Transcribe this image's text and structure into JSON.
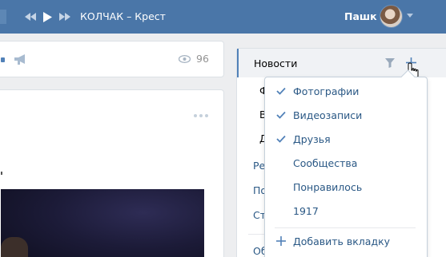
{
  "player": {
    "track": "КОЛЧАК – Крест",
    "prev_icon": "prev-icon",
    "play_icon": "play-icon",
    "next_icon": "next-icon"
  },
  "user": {
    "name": "Пашк",
    "avatar_icon": "avatar"
  },
  "feed": {
    "views": "96",
    "views_icon": "eye-icon",
    "more_icon": "more-dots-icon"
  },
  "right_menu": {
    "active": "Новости",
    "fragments": [
      "Ф",
      "В",
      "Д",
      "Рек",
      "По",
      "Ст",
      "Об"
    ]
  },
  "dropdown": {
    "items": [
      {
        "label": "Фотографии",
        "checked": true
      },
      {
        "label": "Видеозаписи",
        "checked": true
      },
      {
        "label": "Друзья",
        "checked": true
      },
      {
        "label": "Сообщества",
        "checked": false
      },
      {
        "label": "Понравилось",
        "checked": false
      },
      {
        "label": "1917",
        "checked": false
      }
    ],
    "add_tab": "Добавить вкладку"
  },
  "colors": {
    "header": "#4a76a8",
    "link": "#2a5885",
    "accent": "#5181b8",
    "muted": "#939393"
  }
}
